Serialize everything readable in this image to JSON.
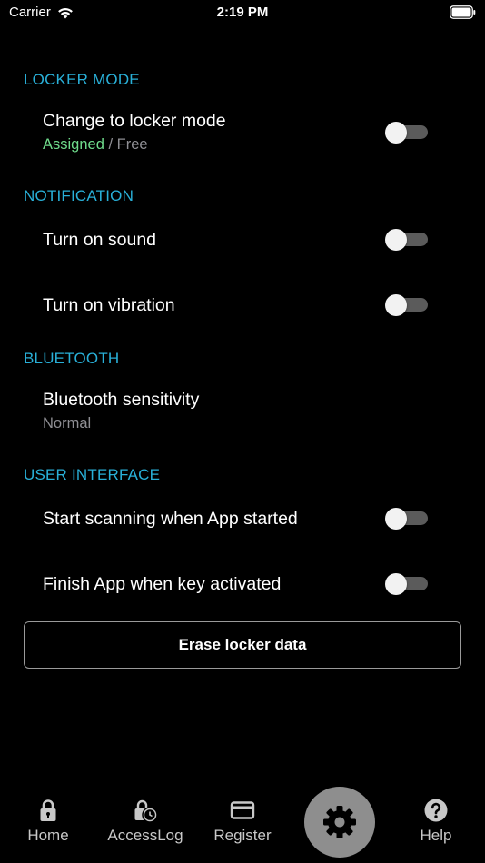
{
  "status_bar": {
    "carrier": "Carrier",
    "time": "2:19 PM"
  },
  "sections": {
    "locker_mode": {
      "header": "LOCKER MODE",
      "change_mode": {
        "title": "Change to locker mode",
        "status_assigned": "Assigned",
        "status_rest": " / Free",
        "enabled": false
      }
    },
    "notification": {
      "header": "NOTIFICATION",
      "sound": {
        "title": "Turn on sound",
        "enabled": false
      },
      "vibration": {
        "title": "Turn on vibration",
        "enabled": false
      }
    },
    "bluetooth": {
      "header": "BLUETOOTH",
      "sensitivity": {
        "title": "Bluetooth sensitivity",
        "value": "Normal"
      }
    },
    "user_interface": {
      "header": "USER INTERFACE",
      "start_scanning": {
        "title": "Start scanning when App started",
        "enabled": false
      },
      "finish_app": {
        "title": "Finish App when key activated",
        "enabled": false
      }
    }
  },
  "erase_button": {
    "label": "Erase locker data"
  },
  "tab_bar": {
    "home": "Home",
    "access_log": "AccessLog",
    "register": "Register",
    "help": "Help"
  },
  "colors": {
    "section_header": "#29b0d8",
    "assigned": "#6fdc8c",
    "background": "#000000",
    "settings_button": "#8e8e8e"
  },
  "icons": {
    "home": "lock-icon",
    "access_log": "lock-clock-icon",
    "register": "card-icon",
    "settings": "gear-icon",
    "help": "question-icon"
  }
}
